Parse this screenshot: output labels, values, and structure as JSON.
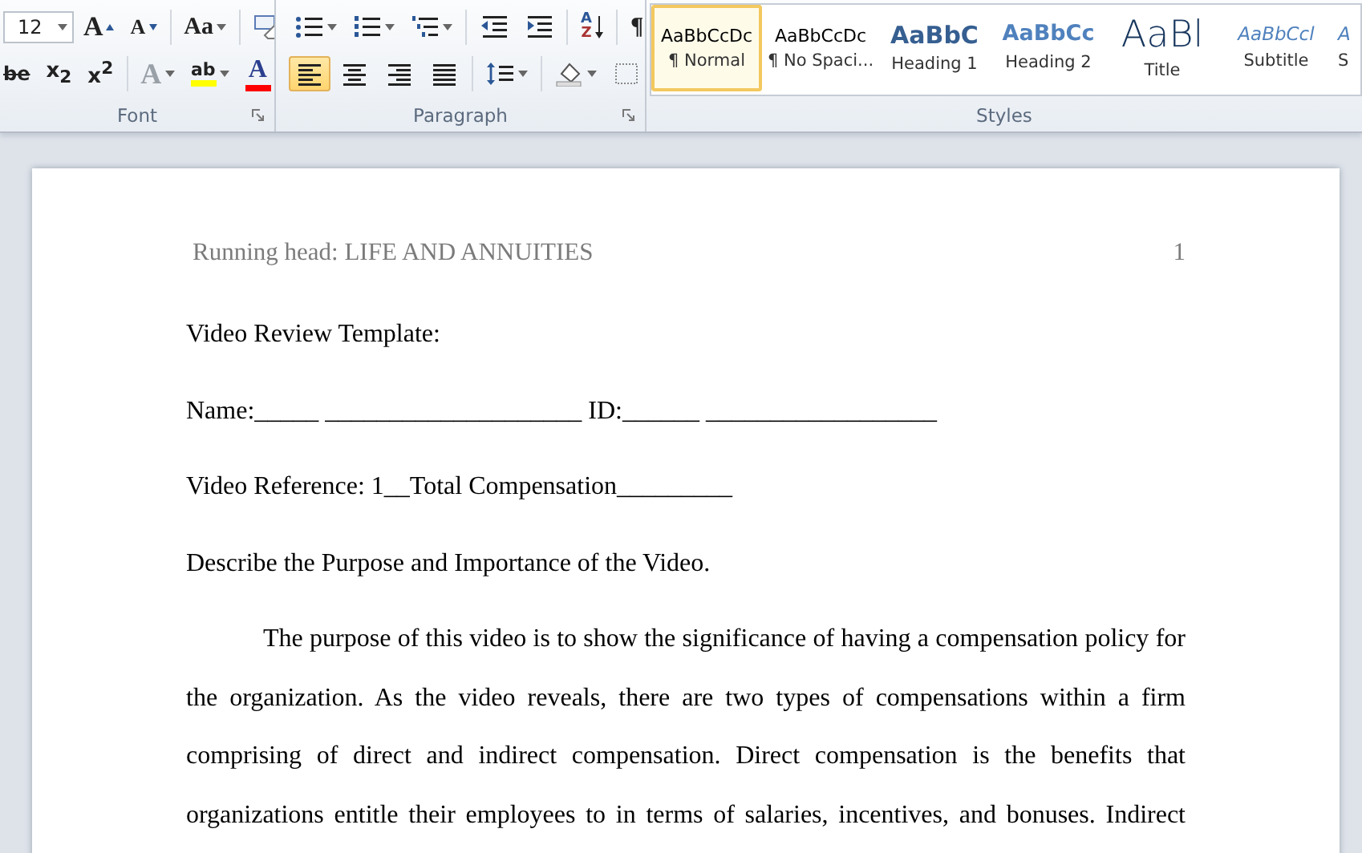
{
  "ribbon": {
    "font_group": {
      "label": "Font",
      "rows": [
        [
          [
            {
              "kind": "size-field",
              "value": "12"
            },
            {
              "kind": "grow-font",
              "text": "A"
            },
            {
              "kind": "shrink-font",
              "text": "A"
            }
          ],
          [
            {
              "kind": "change-case",
              "text": "Aa"
            }
          ],
          [
            {
              "kind": "clear-format"
            }
          ]
        ],
        [
          [
            {
              "kind": "strikethrough",
              "text": "be"
            },
            {
              "kind": "subscript",
              "text": "x$_{2}$"
            },
            {
              "kind": "superscript",
              "text": "x$^{2}$"
            }
          ],
          [
            {
              "kind": "text-effects",
              "text": "A",
              "disabled": true
            },
            {
              "kind": "highlight",
              "text": "ab",
              "color": "#ffff00"
            },
            {
              "kind": "font-color",
              "text": "A",
              "color": "#ff0000"
            }
          ]
        ]
      ]
    },
    "paragraph_group": {
      "label": "Paragraph",
      "rows": [
        [
          [
            {
              "kind": "bullets"
            },
            {
              "kind": "numbering"
            },
            {
              "kind": "multilevel"
            }
          ],
          [
            {
              "kind": "decrease-indent"
            },
            {
              "kind": "increase-indent"
            }
          ],
          [
            {
              "kind": "sort",
              "top": "A",
              "bottom": "Z"
            }
          ],
          [
            {
              "kind": "pilcrow",
              "text": "¶"
            }
          ]
        ],
        [
          [
            {
              "kind": "align-left",
              "selected": true
            },
            {
              "kind": "align-center",
              "selected": false
            },
            {
              "kind": "align-right",
              "selected": false
            },
            {
              "kind": "justify",
              "selected": false
            }
          ],
          [
            {
              "kind": "line-spacing"
            }
          ],
          [
            {
              "kind": "shading"
            },
            {
              "kind": "borders"
            }
          ]
        ]
      ]
    },
    "styles_group": {
      "label": "Styles",
      "items": [
        {
          "kind": "normal",
          "sample": "AaBbCcDc",
          "label": "¶ Normal",
          "selected": true
        },
        {
          "kind": "normal",
          "sample": "AaBbCcDc",
          "label": "¶ No Spaci...",
          "selected": false
        },
        {
          "kind": "heading1",
          "sample": "AaBbC",
          "label": "Heading 1",
          "selected": false
        },
        {
          "kind": "heading2",
          "sample": "AaBbCc",
          "label": "Heading 2",
          "selected": false
        },
        {
          "kind": "title",
          "sample": "AaBl",
          "label": "Title",
          "selected": false
        },
        {
          "kind": "subtitle",
          "sample": "AaBbCcl",
          "label": "Subtitle",
          "selected": false
        },
        {
          "kind": "subtitle",
          "sample": "A",
          "label": "S",
          "selected": false
        }
      ]
    }
  },
  "document": {
    "header": {
      "text": "Running head: LIFE AND ANNUITIES",
      "page_number": "1"
    },
    "paragraphs": [
      {
        "kind": "line",
        "text": "Video Review Template:"
      },
      {
        "kind": "line",
        "text": "Name:_____ ____________________ ID:______ __________________"
      },
      {
        "kind": "line",
        "text": "Video Reference: 1__Total Compensation_________"
      },
      {
        "kind": "line",
        "text": "Describe the Purpose and Importance of the Video."
      },
      {
        "kind": "body",
        "text": "The purpose of this video is to show the significance of having a compensation policy for the organization. As the video reveals, there are two types of compensations within a firm comprising  of direct and indirect compensation. Direct compensation is the benefits that organizations entitle their employees to in terms of salaries, incentives, and bonuses. Indirect"
      }
    ]
  }
}
